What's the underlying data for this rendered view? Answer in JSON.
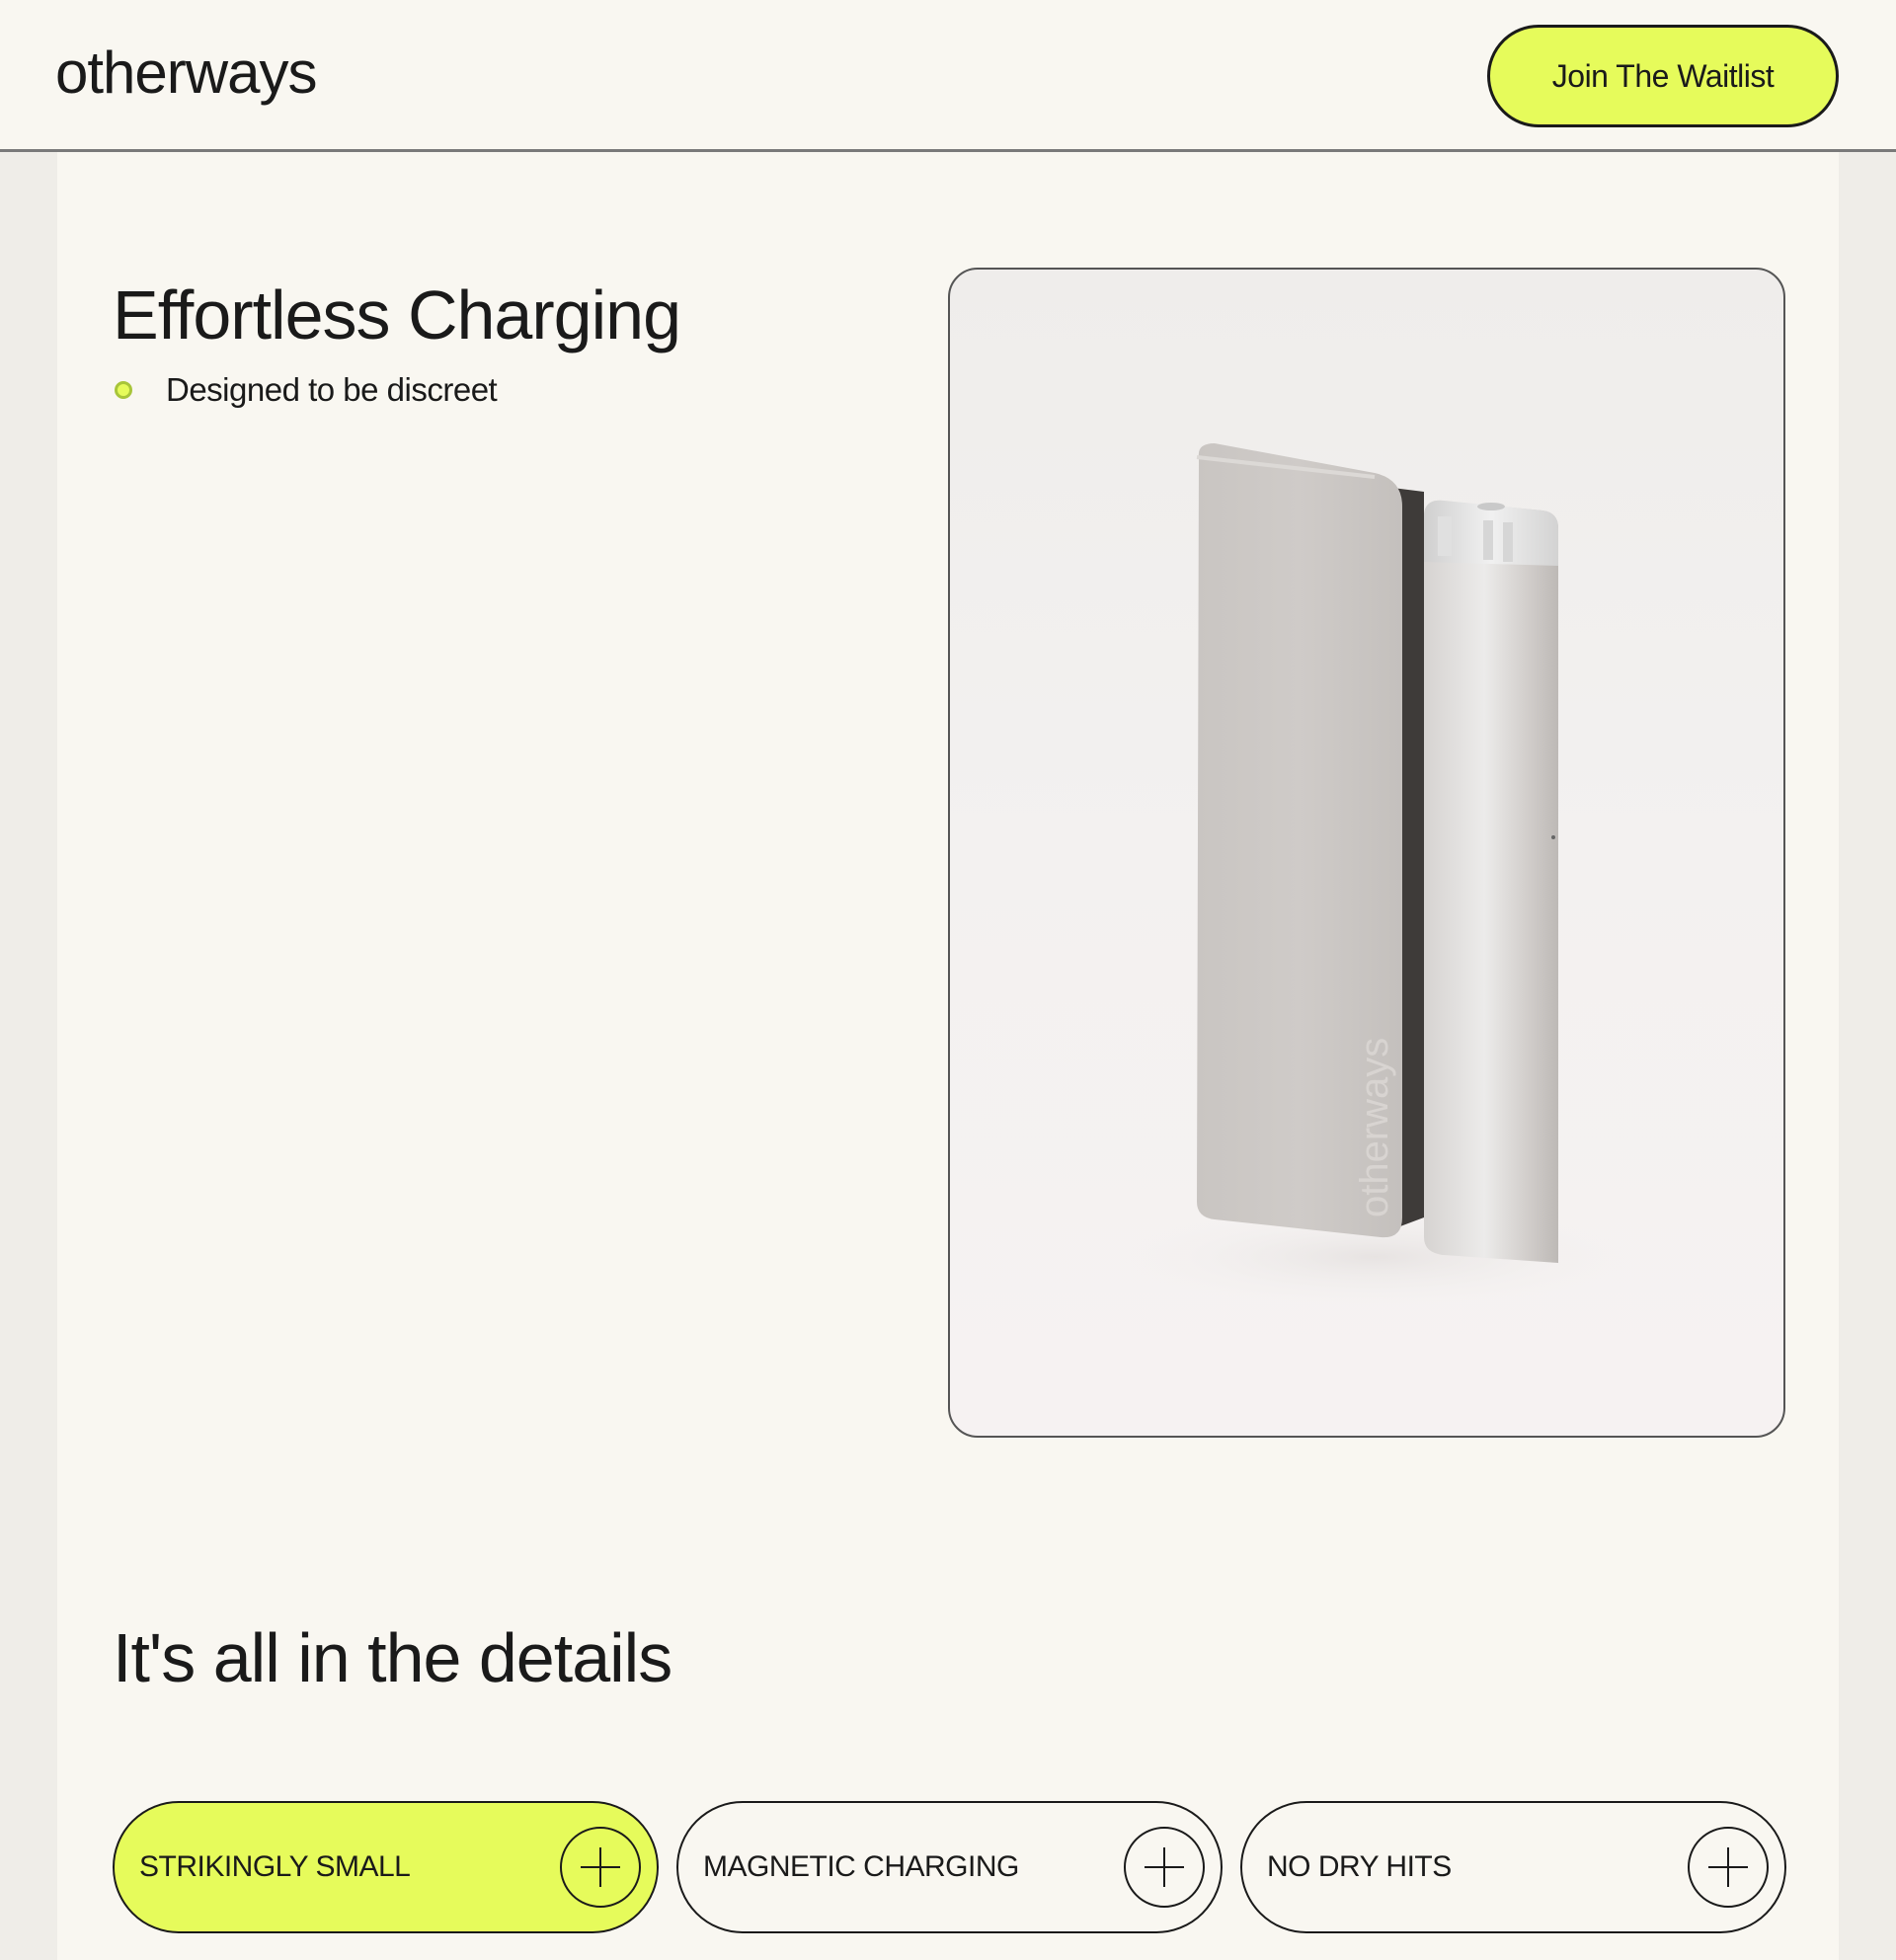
{
  "header": {
    "logo": "otherways",
    "cta_label": "Join The Waitlist"
  },
  "feature": {
    "title": "Effortless Charging",
    "bullet": "Designed to be discreet",
    "device_engraving": "otherways"
  },
  "details": {
    "title": "It's all in the details",
    "items": [
      {
        "label": "STRIKINGLY SMALL",
        "active": true
      },
      {
        "label": "MAGNETIC CHARGING",
        "active": false
      },
      {
        "label": "NO DRY HITS",
        "active": false
      }
    ]
  },
  "colors": {
    "accent": "#e6fb5b",
    "background": "#f9f7f1",
    "text": "#1a1a1a"
  }
}
